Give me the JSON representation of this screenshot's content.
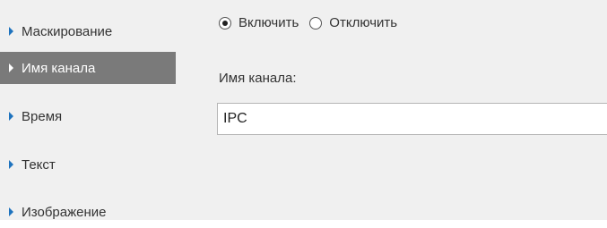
{
  "sidebar": {
    "items": [
      {
        "label": "Маскирование",
        "active": false
      },
      {
        "label": "Имя канала",
        "active": true
      },
      {
        "label": "Время",
        "active": false
      },
      {
        "label": "Текст",
        "active": false
      },
      {
        "label": "Изображение",
        "active": false
      }
    ]
  },
  "main": {
    "mode": {
      "enable_label": "Включить",
      "disable_label": "Отключить",
      "selected": "enable"
    },
    "channel_name": {
      "label": "Имя канала:",
      "value": "IPC"
    }
  },
  "colors": {
    "panel_background": "#f0f0f0",
    "active_item": "#7a7a7a",
    "nav_arrow": "#1e73be"
  }
}
